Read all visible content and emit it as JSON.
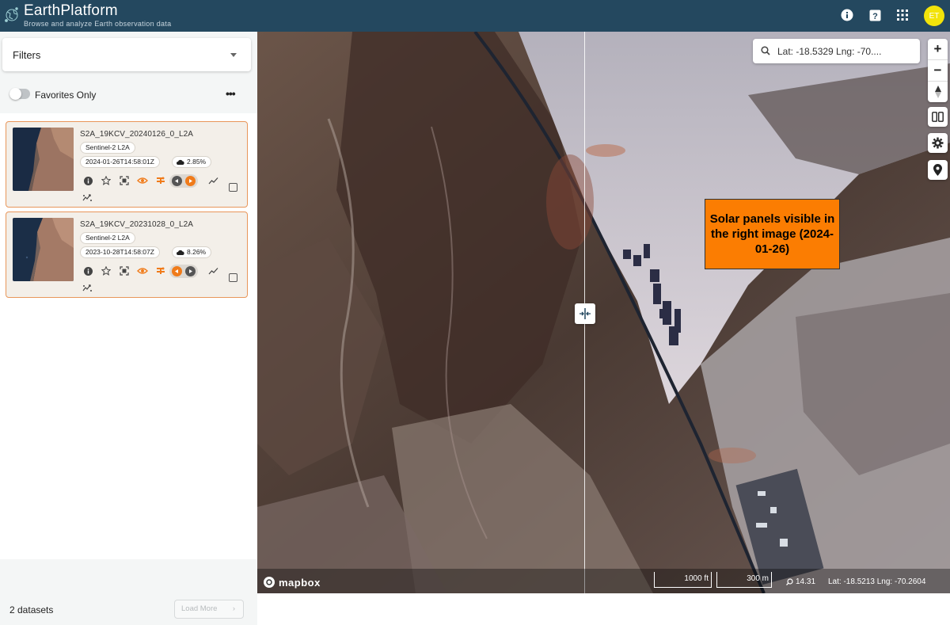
{
  "header": {
    "brand": "EarthPlatform",
    "tagline": "Browse and analyze Earth observation data",
    "avatar_initials": "ET",
    "icons": [
      "info-icon",
      "help-icon",
      "apps-grid-icon"
    ],
    "bg_color": "#24485f"
  },
  "sidebar": {
    "filters_label": "Filters",
    "favorites_label": "Favorites Only",
    "favorites_on": false,
    "datasets": [
      {
        "title": "S2A_19KCV_20240126_0_L2A",
        "collection": "Sentinel-2 L2A",
        "datetime": "2024-01-26T14:58:01Z",
        "cloud_cover": "2.85%"
      },
      {
        "title": "S2A_19KCV_20231028_0_L2A",
        "collection": "Sentinel-2 L2A",
        "datetime": "2023-10-28T14:58:07Z",
        "cloud_cover": "8.26%"
      }
    ],
    "footer_count": "2 datasets",
    "load_more_label": "Load More"
  },
  "map": {
    "search_text": "Lat: -18.5329 Lng: -70....",
    "annotation": "Solar panels visible in the right image (2024-01-26)",
    "mapbox_label": "mapbox",
    "scale_ft": "1000 ft",
    "scale_m": "300 m",
    "zoom": "14.31",
    "cursor_coords": "Lat: -18.5213   Lng: -70.2604",
    "accent_color": "#fb7d02"
  }
}
